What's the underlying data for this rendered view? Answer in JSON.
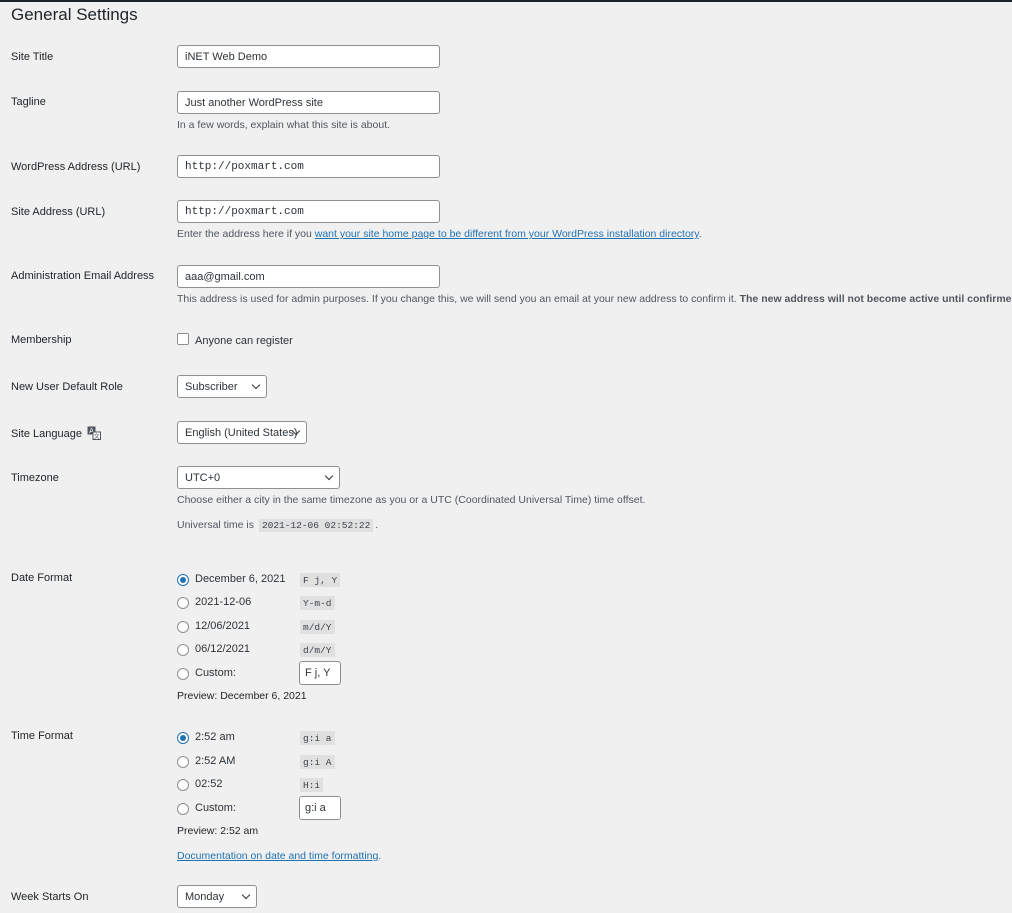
{
  "page_title": "General Settings",
  "fields": {
    "site_title": {
      "label": "Site Title",
      "value": "iNET Web Demo"
    },
    "tagline": {
      "label": "Tagline",
      "value": "Just another WordPress site",
      "description": "In a few words, explain what this site is about."
    },
    "wp_address": {
      "label": "WordPress Address (URL)",
      "value": "http://poxmart.com"
    },
    "site_address": {
      "label": "Site Address (URL)",
      "value": "http://poxmart.com",
      "description_prefix": "Enter the address here if you ",
      "description_link": "want your site home page to be different from your WordPress installation directory",
      "description_suffix": "."
    },
    "admin_email": {
      "label": "Administration Email Address",
      "value": "aaa@gmail.com",
      "description": "This address is used for admin purposes. If you change this, we will send you an email at your new address to confirm it. ",
      "description_bold": "The new address will not become active until confirmed."
    },
    "membership": {
      "label": "Membership",
      "checkbox_label": "Anyone can register",
      "checked": false
    },
    "default_role": {
      "label": "New User Default Role",
      "selected": "Subscriber"
    },
    "site_language": {
      "label": "Site Language",
      "icon": "translation-icon",
      "selected": "English (United States)"
    },
    "timezone": {
      "label": "Timezone",
      "selected": "UTC+0",
      "description": "Choose either a city in the same timezone as you or a UTC (Coordinated Universal Time) time offset.",
      "universal_prefix": "Universal time is",
      "universal_time": "2021-12-06 02:52:22",
      "universal_suffix": "."
    },
    "date_format": {
      "label": "Date Format",
      "options": [
        {
          "label": "December 6, 2021",
          "code": "F j, Y",
          "checked": true
        },
        {
          "label": "2021-12-06",
          "code": "Y-m-d",
          "checked": false
        },
        {
          "label": "12/06/2021",
          "code": "m/d/Y",
          "checked": false
        },
        {
          "label": "06/12/2021",
          "code": "d/m/Y",
          "checked": false
        }
      ],
      "custom_label": "Custom:",
      "custom_value": "F j, Y",
      "preview_label": "Preview:",
      "preview_value": "December 6, 2021"
    },
    "time_format": {
      "label": "Time Format",
      "options": [
        {
          "label": "2:52 am",
          "code": "g:i a",
          "checked": true
        },
        {
          "label": "2:52 AM",
          "code": "g:i A",
          "checked": false
        },
        {
          "label": "02:52",
          "code": "H:i",
          "checked": false
        }
      ],
      "custom_label": "Custom:",
      "custom_value": "g:i a",
      "preview_label": "Preview:",
      "preview_value": "2:52 am",
      "doc_link": "Documentation on date and time formatting",
      "doc_suffix": "."
    },
    "week_starts": {
      "label": "Week Starts On",
      "selected": "Monday"
    }
  },
  "colors": {
    "accent": "#2271b1",
    "text": "#1d2327",
    "background": "#f0f0f1"
  }
}
